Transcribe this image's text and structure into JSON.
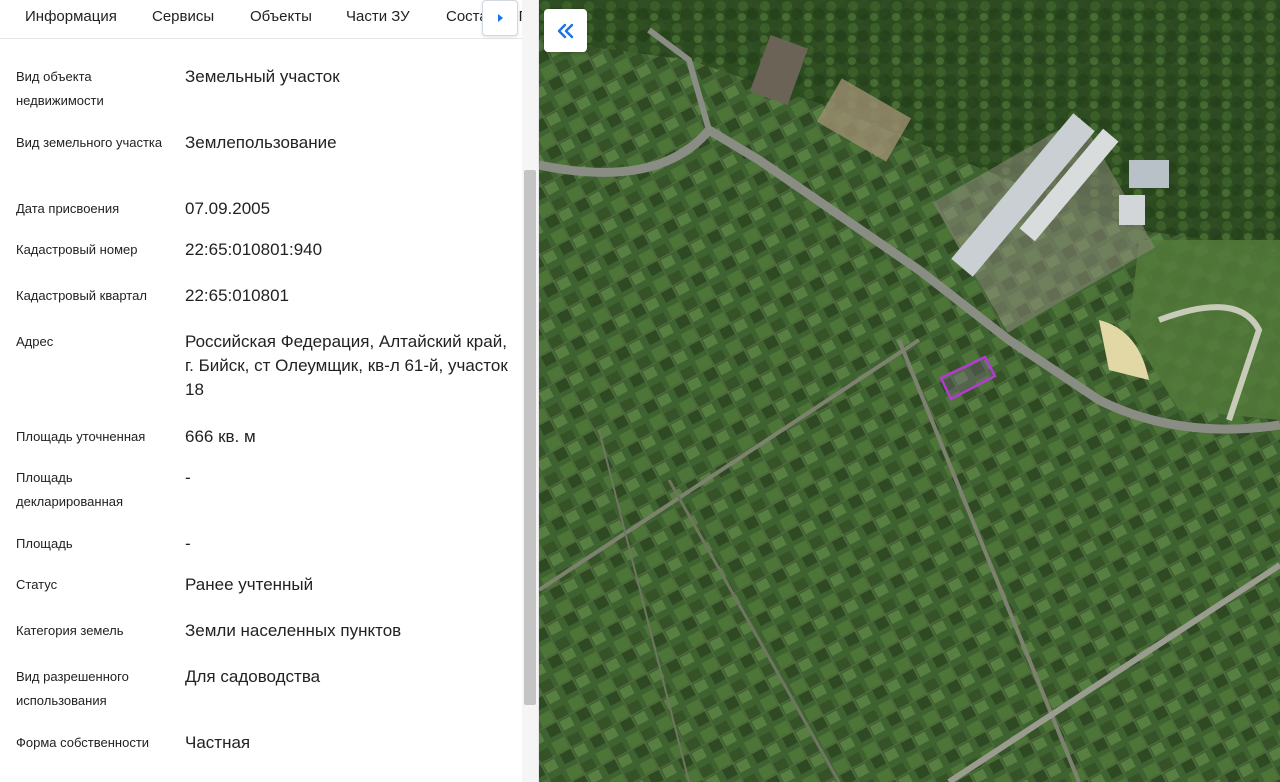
{
  "tabs": [
    {
      "label": "Информация",
      "active": true
    },
    {
      "label": "Сервисы"
    },
    {
      "label": "Объекты"
    },
    {
      "label": "Части ЗУ"
    },
    {
      "label": "Состав ЕЗП"
    }
  ],
  "tab_scroll_icon": "caret-right-icon",
  "collapse_icon": "double-chevron-left-icon",
  "fields": [
    {
      "label": "Вид объекта недвижимости",
      "value": "Земельный участок"
    },
    {
      "label": "Вид земельного участка",
      "value": "Землепользование"
    },
    {
      "label": "Дата присвоения",
      "value": "07.09.2005"
    },
    {
      "label": "Кадастровый номер",
      "value": "22:65:010801:940"
    },
    {
      "label": "Кадастровый квартал",
      "value": "22:65:010801"
    },
    {
      "label": "Адрес",
      "value": "Российская Федерация, Алтайский край, г. Бийск, ст Олеумщик, кв-л 61-й, участок 18"
    },
    {
      "label": "Площадь уточненная",
      "value": "666 кв. м"
    },
    {
      "label": "Площадь декларированная",
      "value": "-"
    },
    {
      "label": "Площадь",
      "value": "-"
    },
    {
      "label": "Статус",
      "value": "Ранее учтенный"
    },
    {
      "label": "Категория земель",
      "value": "Земли населенных пунктов"
    },
    {
      "label": "Вид разрешенного использования",
      "value": "Для садоводства"
    },
    {
      "label": "Форма собственности",
      "value": "Частная"
    }
  ],
  "colors": {
    "accent": "#1a73e8",
    "parcel_outline": "#b23bd1"
  }
}
